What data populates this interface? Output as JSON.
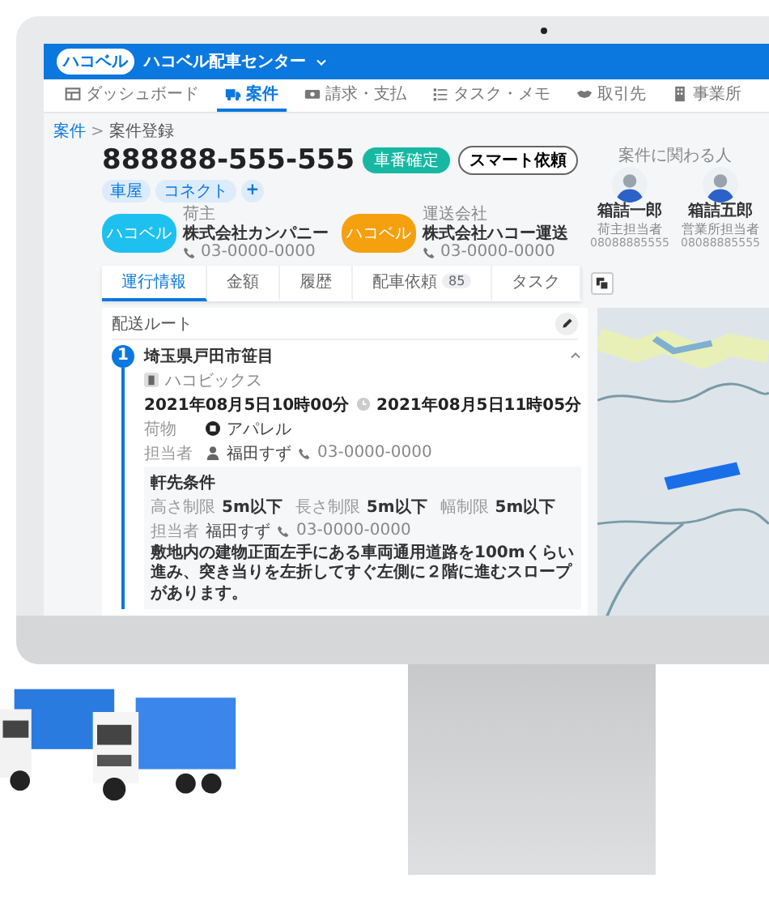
{
  "app": {
    "logo": "ハコベル",
    "title": "ハコベル配車センター"
  },
  "nav": [
    {
      "label": "ダッシュボード",
      "selected": false
    },
    {
      "label": "案件",
      "selected": true
    },
    {
      "label": "請求・支払",
      "selected": false
    },
    {
      "label": "タスク・メモ",
      "selected": false
    },
    {
      "label": "取引先",
      "selected": false
    },
    {
      "label": "事業所",
      "selected": false
    }
  ],
  "breadcrumb": {
    "items": [
      "案件",
      "案件登録"
    ],
    "separator": ">"
  },
  "case": {
    "number": "888888-555-555",
    "status": "車番確定",
    "action": "スマート依頼",
    "tags": [
      "車屋",
      "コネクト"
    ],
    "add_tag": "+"
  },
  "companies": [
    {
      "role": "荷主",
      "name": "株式会社カンパニー",
      "phone": "03-0000-0000",
      "logo": "ハコベル",
      "color": "#1ec0f0"
    },
    {
      "role": "運送会社",
      "name": "株式会社ハコー運送",
      "phone": "03-0000-0000",
      "logo": "ハコベル",
      "color": "#f5a00f"
    }
  ],
  "people": {
    "title": "案件に関わる人",
    "items": [
      {
        "name": "箱詰一郎",
        "role": "荷主担当者",
        "phone": "08088885555"
      },
      {
        "name": "箱詰五郎",
        "role": "営業所担当者",
        "phone": "08088885555"
      }
    ]
  },
  "tabs": [
    {
      "label": "運行情報",
      "selected": true
    },
    {
      "label": "金額",
      "selected": false
    },
    {
      "label": "履歴",
      "selected": false
    },
    {
      "label": "配車依頼",
      "count": "85",
      "selected": false
    },
    {
      "label": "タスク",
      "selected": false
    }
  ],
  "route": {
    "title": "配送ルート",
    "stops": [
      {
        "number": "1",
        "address": "埼玉県戸田市笹目",
        "company": "ハコビックス",
        "start": "2021年08月5日10時00分",
        "end": "2021年08月5日11時05分",
        "cargo_label": "荷物",
        "cargo": "アパレル",
        "contact_label": "担当者",
        "contact": "福田すず",
        "phone": "03-0000-0000",
        "conditions": {
          "title": "軒先条件",
          "items": [
            {
              "label": "高さ制限",
              "value": "5m以下"
            },
            {
              "label": "長さ制限",
              "value": "5m以下"
            },
            {
              "label": "幅制限",
              "value": "5m以下"
            }
          ],
          "contact_label": "担当者",
          "contact": "福田すず",
          "phone": "03-0000-0000",
          "note": "敷地内の建物正面左手にある車両通用道路を100mくらい進み、突き当りを左折してすぐ左側に２階に進むスロープがあります。"
        }
      }
    ]
  }
}
